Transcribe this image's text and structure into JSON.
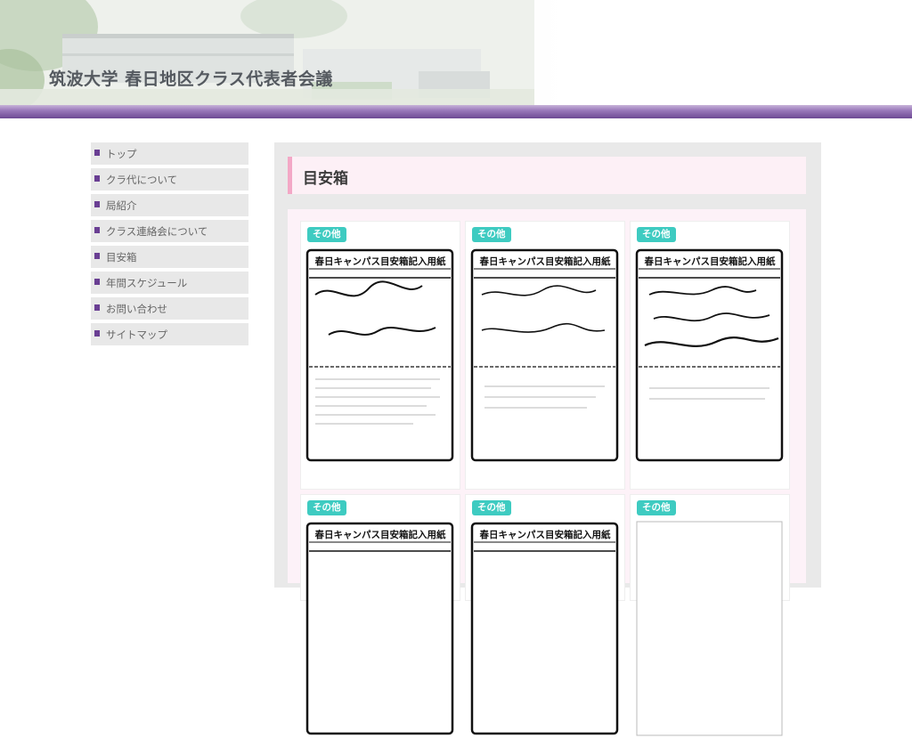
{
  "site": {
    "title": "筑波大学 春日地区クラス代表者会議"
  },
  "nav": [
    {
      "label": "トップ"
    },
    {
      "label": "クラ代について"
    },
    {
      "label": "局紹介"
    },
    {
      "label": "クラス連絡会について"
    },
    {
      "label": "目安箱"
    },
    {
      "label": "年間スケジュール"
    },
    {
      "label": "お問い合わせ"
    },
    {
      "label": "サイトマップ"
    }
  ],
  "page": {
    "heading": "目安箱"
  },
  "cards": [
    {
      "tag": "その他",
      "form_title": "春日キャンパス目安箱記入用紙"
    },
    {
      "tag": "その他",
      "form_title": "春日キャンパス目安箱記入用紙"
    },
    {
      "tag": "その他",
      "form_title": "春日キャンパス目安箱記入用紙"
    },
    {
      "tag": "その他",
      "form_title": "春日キャンパス目安箱記入用紙"
    },
    {
      "tag": "その他",
      "form_title": "春日キャンパス目安箱記入用紙"
    },
    {
      "tag": "その他",
      "form_title": ""
    }
  ],
  "colors": {
    "accent_purple": "#6a3f93",
    "tag_teal": "#3ecbc1",
    "heading_pink": "#f3a8c6"
  }
}
